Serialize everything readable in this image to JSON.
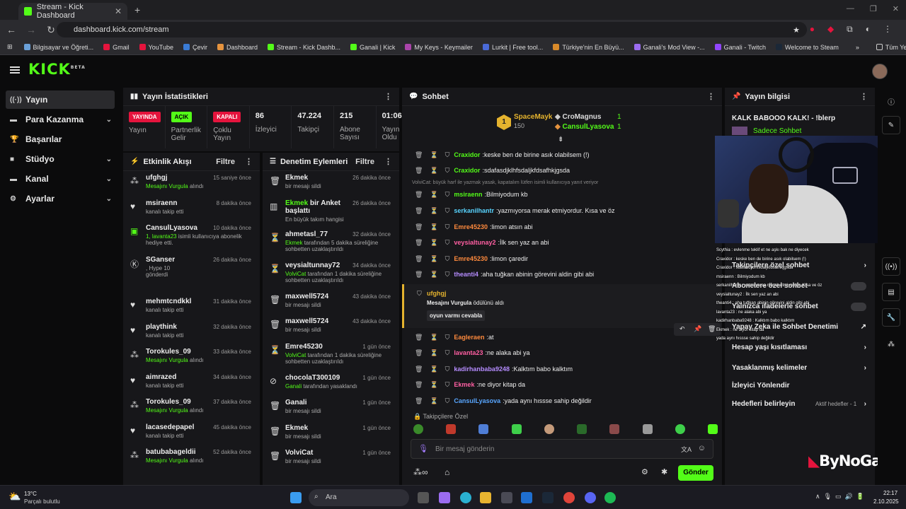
{
  "browser": {
    "tab_title": "Stream - Kick Dashboard",
    "url": "dashboard.kick.com/stream",
    "bookmarks": [
      "Bilgisayar ve Öğreti...",
      "Gmail",
      "YouTube",
      "Çevir",
      "Dashboard",
      "Stream - Kick Dashb...",
      "Ganali | Kick",
      "My Keys - Keymailer",
      "Lurkit | Free tool...",
      "Türkiye'nin En Büyü...",
      "Ganali's Mod View -...",
      "Ganali - Twitch",
      "Welcome to Steam"
    ],
    "all_bookmarks": "Tüm Yer İşaretleri"
  },
  "brand": {
    "logo": "KICK",
    "beta": "BETA",
    "accent": "#53fc18"
  },
  "sidebar": {
    "items": [
      {
        "label": "Yayın",
        "icon": "radio-icon"
      },
      {
        "label": "Para Kazanma",
        "icon": "money-icon"
      },
      {
        "label": "Başarılar",
        "icon": "trophy-icon"
      },
      {
        "label": "Stüdyo",
        "icon": "studio-icon"
      },
      {
        "label": "Kanal",
        "icon": "channel-icon"
      },
      {
        "label": "Ayarlar",
        "icon": "gear-icon"
      }
    ]
  },
  "stats": {
    "title": "Yayın İstatistikleri",
    "items": [
      {
        "badge": "YAYINDA",
        "label": "Yayın",
        "color": "#e5143d"
      },
      {
        "badge": "AÇIK",
        "label": "Partnerlik Gelir",
        "color": "#53fc18"
      },
      {
        "badge": "KAPALI",
        "label": "Çoklu Yayın",
        "color": "#e5143d"
      },
      {
        "value": "86",
        "label": "İzleyici"
      },
      {
        "value": "47.224",
        "label": "Takipçi"
      },
      {
        "value": "215",
        "label": "Abone Sayısı"
      },
      {
        "value": "01:06",
        "label": "Yayın Oldu"
      }
    ]
  },
  "activity": {
    "title": "Etkinlik Akışı",
    "filter": "Filtre",
    "items": [
      {
        "user": "ufghgj",
        "desc": "Mesajını Vurgula",
        "desc2": "alındı",
        "time": "15 saniye önce"
      },
      {
        "user": "msiraenn",
        "desc": "kanalı takip etti",
        "time": "8 dakika önce"
      },
      {
        "user": "CansulLyasova",
        "desc": "1, lavanta23",
        "desc2": "isimli kullanıcıya abonelik hediye etti.",
        "time": "10 dakika önce"
      },
      {
        "user": "SGanser",
        "desc": ", Hype",
        "desc2": "10",
        "desc3": "gönderdi",
        "time": "26 dakika önce"
      },
      {
        "user": "mehmtcndkkl",
        "desc": "kanalı takip etti",
        "time": "31 dakika önce"
      },
      {
        "user": "playthink",
        "desc": "kanalı takip etti",
        "time": "32 dakika önce"
      },
      {
        "user": "Torokules_09",
        "desc": "Mesajını Vurgula",
        "desc2": "alındı",
        "time": "33 dakika önce"
      },
      {
        "user": "aimrazed",
        "desc": "kanalı takip etti",
        "time": "34 dakika önce"
      },
      {
        "user": "Torokules_09",
        "desc": "Mesajını Vurgula",
        "desc2": "alındı",
        "time": "37 dakika önce"
      },
      {
        "user": "lacasedepapel",
        "desc": "kanalı takip etti",
        "time": "45 dakika önce"
      },
      {
        "user": "batubabageldii",
        "desc": "Mesajını Vurgula",
        "desc2": "alındı",
        "time": "52 dakika önce"
      }
    ]
  },
  "moderation": {
    "title": "Denetim Eylemleri",
    "filter": "Filtre",
    "items": [
      {
        "user": "Ekmek",
        "desc": "bir mesajı sildi",
        "time": "26 dakika önce"
      },
      {
        "user": "Ekmek",
        "user2": "bir Anket başlattı",
        "desc": "En büyük takım hangisi",
        "time": "26 dakika önce"
      },
      {
        "user": "ahmetasl_77",
        "desc": "Ekmek",
        "desc2": "tarafından 5 dakika süreliğine sohbetten uzaklaştırıldı",
        "time": "32 dakika önce"
      },
      {
        "user": "veysialtunnay72",
        "desc": "VolviCat",
        "desc2": "tarafından 1 dakika süreliğine sohbetten uzaklaştırıldı",
        "time": "34 dakika önce"
      },
      {
        "user": "maxwell5724",
        "desc": "bir mesajı sildi",
        "time": "43 dakika önce"
      },
      {
        "user": "maxwell5724",
        "desc": "bir mesajı sildi",
        "time": "43 dakika önce"
      },
      {
        "user": "Emre45230",
        "desc": "VolviCat",
        "desc2": "tarafından 1 dakika süreliğine sohbetten uzaklaştırıldı",
        "time": "1 gün önce"
      },
      {
        "user": "chocolaT300109",
        "desc": "Ganali",
        "desc2": "tarafından yasaklandı",
        "time": "1 gün önce"
      },
      {
        "user": "Ganali",
        "desc": "bir mesajı sildi",
        "time": "1 gün önce"
      },
      {
        "user": "Ekmek",
        "desc": "bir mesajı sildi",
        "time": "1 gün önce"
      },
      {
        "user": "VolviCat",
        "desc": "bir mesajı sildi",
        "time": "1 gün önce"
      }
    ]
  },
  "chat": {
    "title": "Sohbet",
    "leaderboard": [
      {
        "rank": "1",
        "name": "SpaceMayk",
        "count": "150"
      },
      {
        "name": "CroMagnus",
        "count": "1"
      },
      {
        "name": "CansulLyasova",
        "count": "1"
      }
    ],
    "reply_note": "VolviCat: büyük harf ile yazmak yasak, kapatalım lütfen isimli kullanıcıya yanıt veriyor",
    "messages": [
      {
        "user": "Craxidor",
        "text": "keske ben de birine asık olabilsem (!)",
        "color": "#53fc18"
      },
      {
        "user": "Craxidor",
        "text": "sdafasdjklhfsdaljkfdsafhkjgsda",
        "color": "#53fc18"
      },
      {
        "user": "msiraenn",
        "text": "Bilmiyodum kb",
        "color": "#53fc18"
      },
      {
        "user": "serkanilhantr",
        "text": "yazmıyorsa merak etmiyordur. Kısa ve öz",
        "color": "#58d4ff"
      },
      {
        "user": "Emre45230",
        "text": "limon atsın abi",
        "color": "#ff8a3d"
      },
      {
        "user": "veysialtunay2",
        "text": "İlk sen yaz an abi",
        "color": "#ff5fa2"
      },
      {
        "user": "Emre45230",
        "text": "limon çaredir",
        "color": "#ff8a3d"
      },
      {
        "user": "theanti4",
        "text": "aha tuğkan abinin görevini aldin gibi abi",
        "color": "#b58cff"
      }
    ],
    "highlight": {
      "user": "ufghgj",
      "desc": "Mesajını Vurgula",
      "desc2": "ödülünü aldı",
      "message": "oyun varmı cevabla"
    },
    "messages2": [
      {
        "user": "Eagleraen",
        "text": "at",
        "color": "#ff8a3d"
      },
      {
        "user": "lavanta23",
        "text": "ne alaka abi ya",
        "color": "#ff5fa2"
      },
      {
        "user": "kadirhanbaba9248",
        "text": "Kalktım babo kalktım",
        "color": "#b58cff"
      },
      {
        "user": "Ekmek",
        "text": "ne diyor kitap da",
        "color": "#ff5fa2"
      },
      {
        "user": "CansulLyasova",
        "text": "yada aynı hıssse sahip değildir",
        "color": "#58a6ff"
      }
    ],
    "followers_only": "Takipçilere Özel",
    "input_placeholder": "Bir mesaj gönderin",
    "send": "Gönder"
  },
  "stream_info": {
    "title": "Yayın bilgisi",
    "stream_title": "KALK BABOOO KALK! - !blerp",
    "subtitle": "Sadece Sohbet",
    "rows": [
      "Takipçilere özel sohbet",
      "Abonelere özel sohbet",
      "Yalnızca ifadelerle sohbet",
      "Yapay Zeka ile Sohbet Denetimi",
      "Hesap yaşı kısıtlaması",
      "Yasaklanmış kelimeler",
      "İzleyici Yönlendir",
      "Hedefleri belirleyin"
    ],
    "goals_status": "Aktif hedefler - 1"
  },
  "overlay": {
    "brand": "ByNoGame",
    "lines": [
      "Scythia : evlenme teklif et ne aşkı bak ne diyecek",
      "Craxidor : keske ben de birine asık olabilsem (!)",
      "Craxidor : sdafasdjklhfsdaljkfdsafhkjgsda",
      "msiraenn : Bilmiyodum kb",
      "serkanilhantr : yazmıyorsa merak etmiyordur. Kısa ve öz",
      "veysialtunay2 : İlk sen yaz an abi",
      "theanti4 : aha tuğkan abinin görevini aldin gibi abi",
      "lavanta23 : ne alaka abi ya",
      "kadirhanbaba9248 : Kalktım babo kalktım",
      "Ekmek : ne diyor kitap da",
      "yada aynı hıssse sahip değildir"
    ]
  },
  "taskbar": {
    "weather_temp": "13°C",
    "weather_desc": "Parçalı bulutlu",
    "search": "Ara",
    "time": "22:17",
    "date": "2.10.2025"
  }
}
